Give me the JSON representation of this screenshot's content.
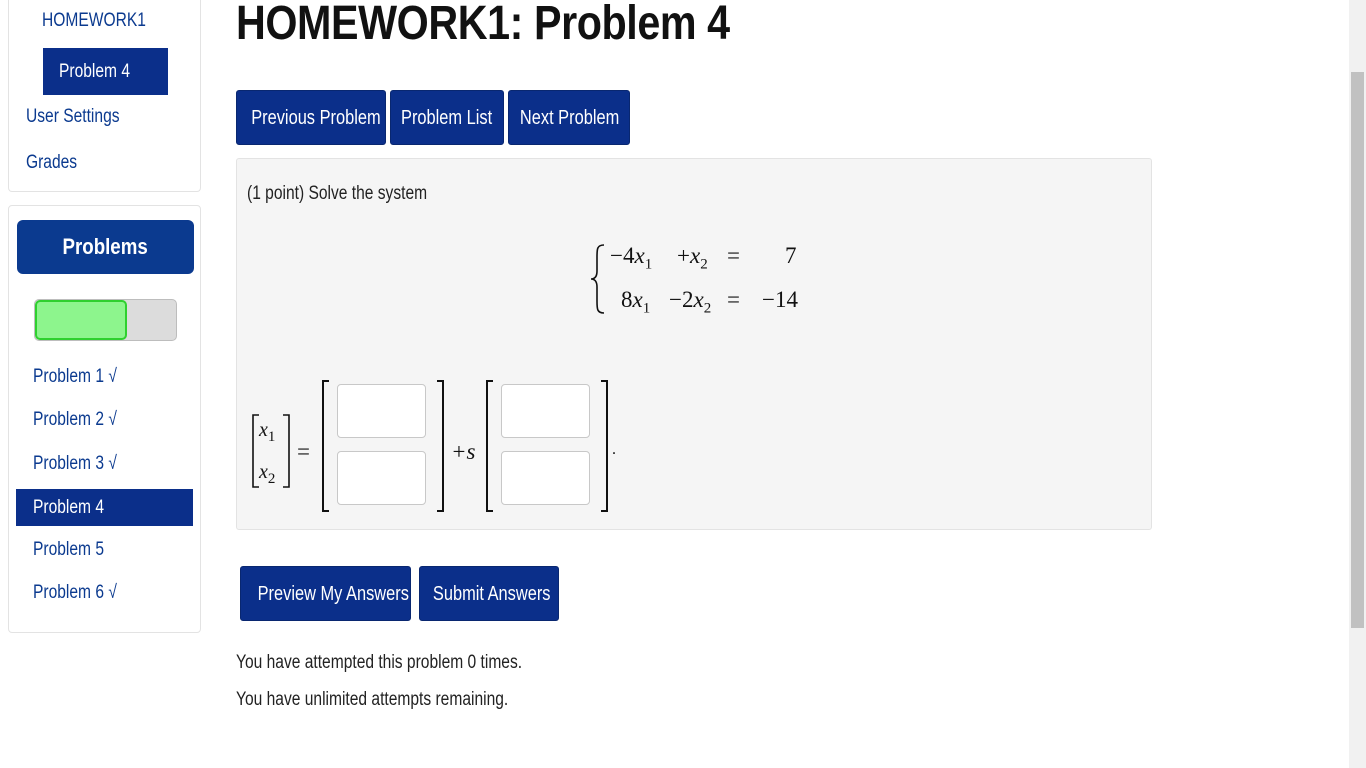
{
  "nav": {
    "homework_link": "HOMEWORK1",
    "current_problem": "Problem 4",
    "user_settings": "User Settings",
    "grades": "Grades"
  },
  "problems_panel": {
    "header": "Problems",
    "progress_fraction": 0.65,
    "progress_color": "#8df58d",
    "items": [
      {
        "label": "Problem 1 √"
      },
      {
        "label": "Problem 2 √"
      },
      {
        "label": "Problem 3 √"
      },
      {
        "label": "Problem 4"
      },
      {
        "label": "Problem 5"
      },
      {
        "label": "Problem 6 √"
      }
    ]
  },
  "main": {
    "title": "HOMEWORK1: Problem 4",
    "buttons": {
      "previous": "Previous Problem",
      "list": "Problem List",
      "next": "Next Problem"
    },
    "problem": {
      "intro": "(1 point) Solve the system",
      "system": {
        "row1": {
          "a": "−4",
          "b": "+",
          "rhs": "7"
        },
        "row2": {
          "a": "8",
          "b": "−2",
          "rhs": "−14"
        },
        "var": "x",
        "eq": "="
      },
      "answer": {
        "lhs_var": "x",
        "equals": "=",
        "plus_s": "+s",
        "period": "."
      }
    },
    "actions": {
      "preview": "Preview My Answers",
      "submit": "Submit Answers"
    },
    "status": {
      "attempts": "You have attempted this problem 0 times.",
      "remaining": "You have unlimited attempts remaining."
    }
  },
  "colors": {
    "primary": "#0b2f8a",
    "link": "#0b3a8f",
    "panel_bg": "#f5f5f5"
  }
}
